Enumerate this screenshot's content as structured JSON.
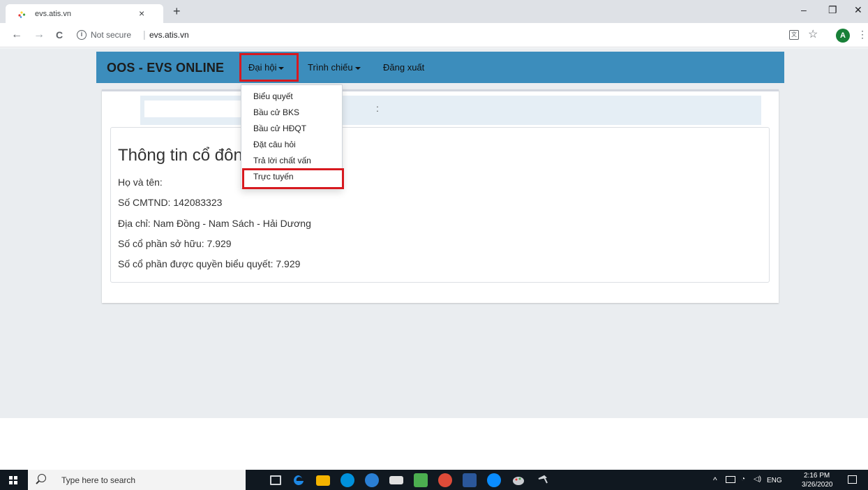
{
  "browser": {
    "tab_title": "evs.atis.vn",
    "tab_close": "×",
    "new_tab": "+",
    "window": {
      "minimize": "–",
      "restore": "❐",
      "close": "✕"
    },
    "nav": {
      "back": "←",
      "forward": "→",
      "reload": "C"
    },
    "security": "Not secure",
    "separator": "|",
    "url": "evs.atis.vn",
    "avatar_letter": "A",
    "icons": [
      "info-icon",
      "translate-icon",
      "star-icon",
      "menu-dots-icon"
    ]
  },
  "navbar": {
    "brand": "OOS - EVS ONLINE",
    "menu_dai_hoi": "Đại hội",
    "menu_trinh_chieu": "Trình chiếu",
    "menu_dang_xuat": "Đăng xuất",
    "accent_color": "#3c8dbc",
    "highlight_color": "#d7191f"
  },
  "dropdown": {
    "items": [
      "Biểu quyết",
      "Bầu cử BKS",
      "Bầu cử HĐQT",
      "Đặt câu hỏi",
      "Trả lời chất vấn",
      "Trực tuyến"
    ],
    "highlighted_item": "Trực tuyến"
  },
  "strip_mark": ":",
  "info": {
    "title": "Thông tin cổ đông",
    "name_line": "Họ và tên:",
    "id_line": "Số CMTND: 142083323",
    "address_line": "Địa chỉ: Nam Đồng - Nam Sách - Hải Dương",
    "shares_line": "Số cổ phần sở hữu: 7.929",
    "voting_shares_line": "Số cổ phần được quyền biểu quyết: 7.929"
  },
  "taskbar": {
    "search_placeholder": "Type here to search",
    "apps": [
      "task-view-icon",
      "edge-icon",
      "file-explorer-icon",
      "skype-icon",
      "app-icon",
      "tablet-icon",
      "snip-icon",
      "chrome-icon",
      "word-icon",
      "zalo-icon",
      "paint-icon",
      "tool-icon"
    ],
    "zalo_label": "Zalo",
    "tray_caret": "^",
    "language": "ENG",
    "time": "2:16 PM",
    "date": "3/26/2020"
  }
}
